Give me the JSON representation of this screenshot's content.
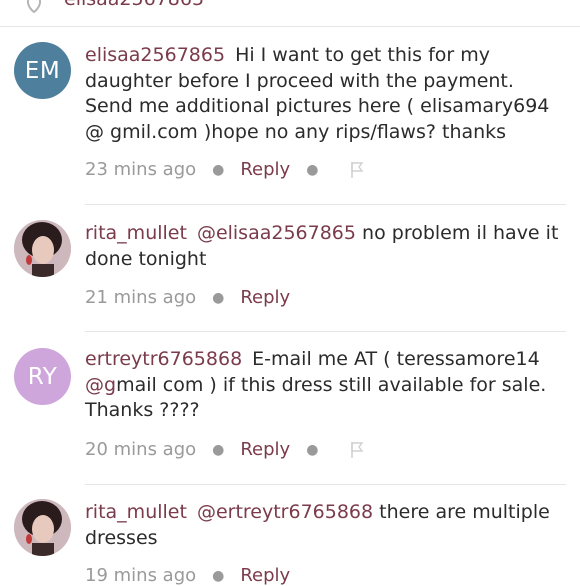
{
  "top": {
    "username": "elisaa2567865"
  },
  "comments": [
    {
      "initials": "EM",
      "avatar_color": "#4e7f9c",
      "user": "elisaa2567865",
      "mention": "",
      "text": "Hi I want to get this for my daughter before I proceed with the payment. Send me additional pictures here ( elisamary694 @ gmil.com )hope no any rips/flaws? thanks",
      "time": "23 mins ago",
      "reply": "Reply"
    },
    {
      "initials": "",
      "user": "rita_mullet",
      "mention": "@elisaa2567865",
      "text": "no problem il have it done tonight",
      "time": "21 mins ago",
      "reply": "Reply"
    },
    {
      "initials": "RY",
      "avatar_color": "#cfa6dc",
      "user": "ertreytr6765868",
      "mention": "",
      "text_pre": "E-mail me AT ( teressamore14 ",
      "text_mention": "@g",
      "text_post": "mail com ) if this dress still available for sale. Thanks ????",
      "time": "20 mins ago",
      "reply": "Reply"
    },
    {
      "initials": "",
      "user": "rita_mullet",
      "mention": "@ertreytr6765868",
      "text": "there are multiple dresses",
      "time": "19 mins ago",
      "reply": "Reply"
    }
  ],
  "colors": {
    "accent": "#7a3b4c",
    "muted": "#9a9a9a",
    "divider": "#e6e6e6"
  },
  "icons": {
    "flag": "flag-icon",
    "like": "heart-icon"
  }
}
